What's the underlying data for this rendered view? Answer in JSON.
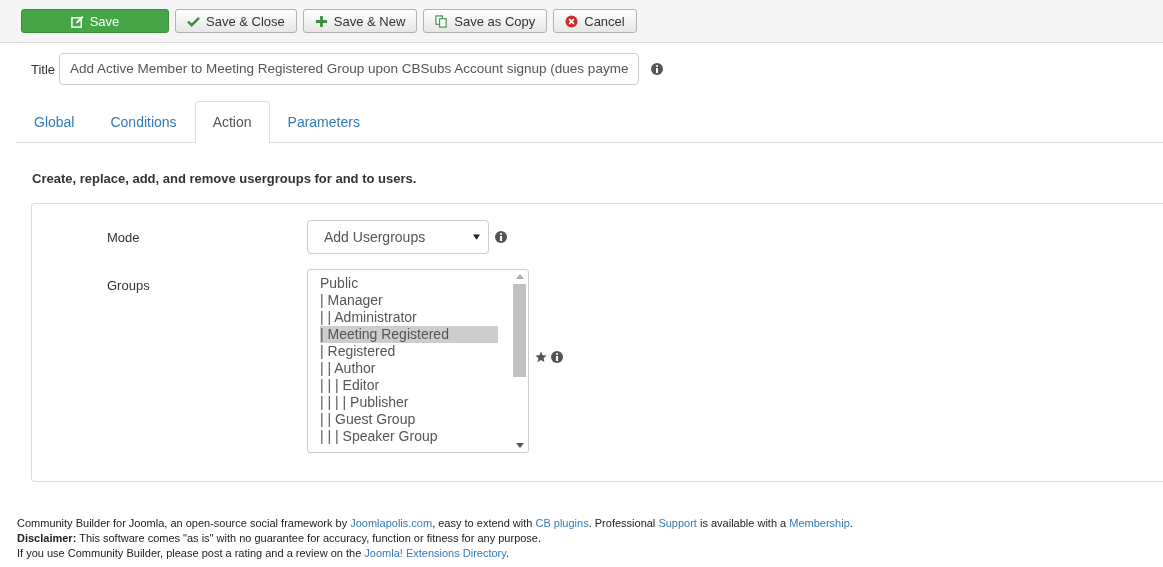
{
  "toolbar": {
    "buttons": [
      {
        "label": "Save",
        "kind": "save"
      },
      {
        "label": "Save & Close",
        "kind": "check"
      },
      {
        "label": "Save & New",
        "kind": "plus"
      },
      {
        "label": "Save as Copy",
        "kind": "copy"
      },
      {
        "label": "Cancel",
        "kind": "cancel"
      }
    ]
  },
  "title_field": {
    "label": "Title",
    "value": "Add Active Member to Meeting Registered Group upon CBSubs Account signup (dues payme"
  },
  "tabs": [
    {
      "label": "Global",
      "selected": false
    },
    {
      "label": "Conditions",
      "selected": false
    },
    {
      "label": "Action",
      "selected": true
    },
    {
      "label": "Parameters",
      "selected": false
    }
  ],
  "description": "Create, replace, add, and remove usergroups for and to users.",
  "form": {
    "mode": {
      "label": "Mode",
      "value": "Add Usergroups"
    },
    "groups": {
      "label": "Groups",
      "options": [
        {
          "label": "Public",
          "selected": false
        },
        {
          "label": "| Manager",
          "selected": false
        },
        {
          "label": "| | Administrator",
          "selected": false
        },
        {
          "label": "| Meeting Registered",
          "selected": true
        },
        {
          "label": "| Registered",
          "selected": false
        },
        {
          "label": "| | Author",
          "selected": false
        },
        {
          "label": "| | | Editor",
          "selected": false
        },
        {
          "label": "| | | | Publisher",
          "selected": false
        },
        {
          "label": "| | Guest Group",
          "selected": false
        },
        {
          "label": "| | | Speaker Group",
          "selected": false
        }
      ]
    }
  },
  "footer": [
    [
      {
        "kind": "text",
        "text": "Community Builder for Joomla, an open-source social framework by "
      },
      {
        "kind": "link",
        "text": "Joomlapolis.com"
      },
      {
        "kind": "text",
        "text": ", easy to extend with "
      },
      {
        "kind": "link",
        "text": "CB plugins"
      },
      {
        "kind": "text",
        "text": ". Professional "
      },
      {
        "kind": "link",
        "text": "Support"
      },
      {
        "kind": "text",
        "text": " is available with a "
      },
      {
        "kind": "link",
        "text": "Membership"
      },
      {
        "kind": "text",
        "text": "."
      }
    ],
    [
      {
        "kind": "text",
        "text": "**Disclaimer:** This software comes \"as is\" with no guarantee for accuracy, function or fitness for any purpose."
      }
    ],
    [
      {
        "kind": "text",
        "text": "If you use Community Builder, please post a rating and a review on the "
      },
      {
        "kind": "link",
        "text": "Joomla! Extensions Directory"
      },
      {
        "kind": "text",
        "text": "."
      }
    ]
  ]
}
